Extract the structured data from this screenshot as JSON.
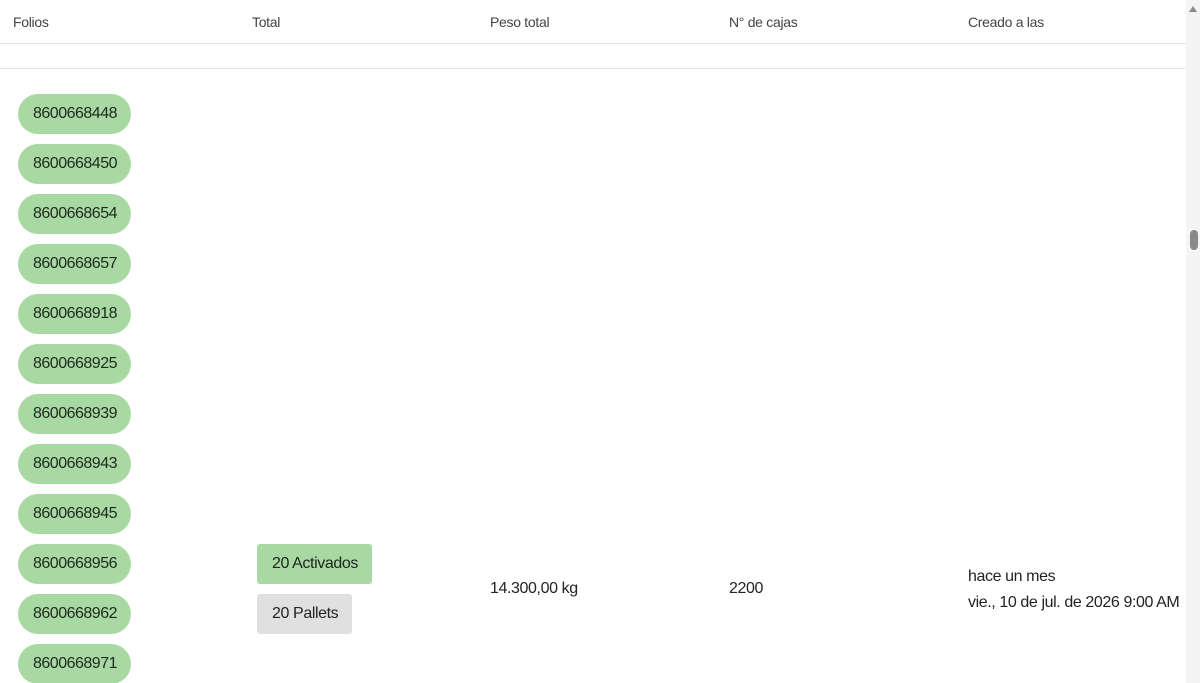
{
  "table": {
    "headers": {
      "folios": "Folios",
      "total": "Total",
      "peso_total": "Peso total",
      "num_cajas": "N° de cajas",
      "creado": "Creado a las"
    },
    "row": {
      "folios": [
        "8600668448",
        "8600668450",
        "8600668654",
        "8600668657",
        "8600668918",
        "8600668925",
        "8600668939",
        "8600668943",
        "8600668945",
        "8600668956",
        "8600668962",
        "8600668971"
      ],
      "total_activados": "20 Activados",
      "total_pallets": "20 Pallets",
      "peso_total": "14.300,00 kg",
      "num_cajas": "2200",
      "creado_relativo": "hace un mes",
      "creado_fecha": "vie., 10 de jul. de 2026 9:00 AM"
    }
  },
  "colors": {
    "folio_chip": "#a8d9a3",
    "activados_tag": "#a8d9a3",
    "pallets_tag": "#e0e0e0"
  }
}
